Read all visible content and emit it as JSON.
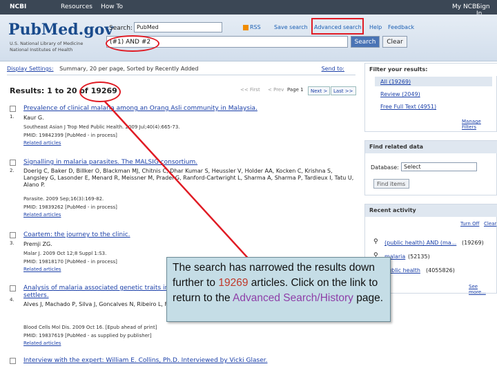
{
  "topbar": {
    "ncbi": "NCBI",
    "resources": "Resources",
    "howto": "How To",
    "myncbi": "My NCBI",
    "signin": "Sign In"
  },
  "header": {
    "logo": "PubMed.gov",
    "logo_sub1": "U.S. National Library of Medicine",
    "logo_sub2": "National Institutes of Health",
    "search_label": "Search:",
    "database": "PubMed",
    "rss": "RSS",
    "save_search": "Save search",
    "advanced_search": "Advanced search",
    "help": "Help",
    "feedback": "Feedback",
    "query": "(#1) AND #2",
    "search_button": "Search",
    "clear_button": "Clear"
  },
  "display_bar": {
    "display_settings": "Display Settings:",
    "summary": "Summary, 20 per page, Sorted by Recently Added",
    "send_to": "Send to:"
  },
  "results": {
    "prefix": "Results: 1 to 20 of ",
    "count": "19269"
  },
  "pager": {
    "first": "<< First",
    "prev": "< Prev",
    "page": "Page 1",
    "next": "Next >",
    "last": "Last >>"
  },
  "items": [
    {
      "num": "1.",
      "title": "Prevalence of clinical malaria among an Orang Asli community in Malaysia.",
      "authors": "Kaur G.",
      "source": "Southeast Asian J Trop Med Public Health. 2009 Jul;40(4):665-73.",
      "pmid": "PMID: 19842399 [PubMed - in process]",
      "related": "Related articles"
    },
    {
      "num": "2.",
      "title": "Signalling in malaria parasites. The MALSIG consortium.",
      "authors": "Doerig C, Baker D, Billker O, Blackman MJ, Chitnis C, Dhar Kumar S, Heussler V, Holder AA, Kocken C, Krishna S, Langsley G, Lasonder E, Menard R, Meissner M, Pradel G, Ranford-Cartwright L, Sharma A, Sharma P, Tardieux I, Tatu U, Alano P.",
      "source": "Parasite. 2009 Sep;16(3):169-82.",
      "pmid": "PMID: 19839262 [PubMed - in process]",
      "related": "Related articles"
    },
    {
      "num": "3.",
      "title": "Coartem: the journey to the clinic.",
      "authors": "Premji ZG.",
      "source": "Malar J. 2009 Oct 12;8 Suppl 1:S3.",
      "pmid": "PMID: 19818170 [PubMed - in process]",
      "related": "Related articles"
    },
    {
      "num": "4.",
      "title": "Analysis of malaria associated genetic traits in Cabo Verde, a melting pot of European and sub Saharan settlers.",
      "authors": "Alves J, Machado P, Silva J, Goncalves N, Ribeiro L, Faustino P, do Rosario VE, Manco L, Gusmao L, Amorim A, Arez AP.",
      "source": "Blood Cells Mol Dis. 2009 Oct 16. [Epub ahead of print]",
      "pmid": "PMID: 19837619 [PubMed - as supplied by publisher]",
      "related": "Related articles"
    },
    {
      "num": "5.",
      "title": "Interview with the expert: William E. Collins, Ph.D. Interviewed by Vicki Glaser.",
      "authors": "",
      "source": "",
      "pmid": "",
      "related": ""
    }
  ],
  "sidebar": {
    "filter_head": "Filter your results:",
    "filters": [
      "All (19269)",
      "Review (2049)",
      "Free Full Text (4951)"
    ],
    "manage_filters": "Manage Filters",
    "related_head": "Find related data",
    "database_label": "Database:",
    "database_value": "Select",
    "find_items": "Find items",
    "recent_head": "Recent activity",
    "turn_off": "Turn Off",
    "clear": "Clear",
    "recent": [
      {
        "text": "(public health) AND (ma...",
        "count": "(19269)"
      },
      {
        "text": "malaria",
        "count": "(52135)"
      },
      {
        "text": "public health",
        "count": "(4055826)"
      }
    ],
    "see_more": "See more..."
  },
  "tooltip": {
    "t1": "The search has narrowed the results down further to ",
    "count": "19269",
    "t2": " articles. Click on the link to return to the ",
    "link": "Advanced Search/History",
    "t3": " page."
  },
  "colors": {
    "annotation": "#e01b24",
    "tooltip_bg": "#c5dde6",
    "link": "#1a3fa8"
  }
}
